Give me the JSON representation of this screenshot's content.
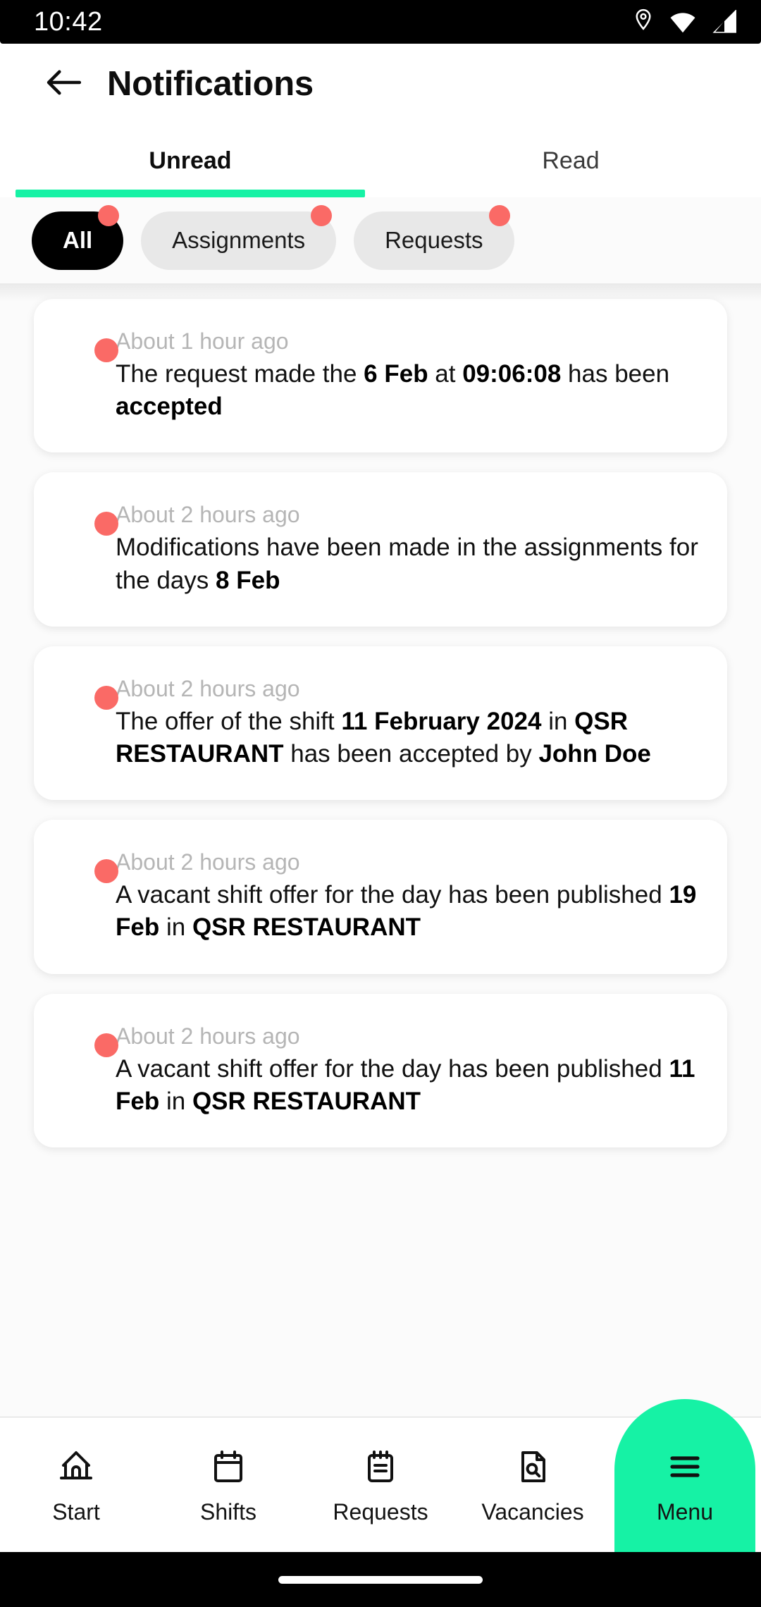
{
  "status_bar": {
    "time": "10:42",
    "icons": [
      "location-icon",
      "wifi-icon",
      "signal-icon"
    ]
  },
  "header": {
    "back_icon": "arrow-left-icon",
    "title": "Notifications"
  },
  "tabs": [
    {
      "label": "Unread",
      "active": true
    },
    {
      "label": "Read",
      "active": false
    }
  ],
  "filter_chips": [
    {
      "label": "All",
      "selected": true,
      "badge": true
    },
    {
      "label": "Assignments",
      "selected": false,
      "badge": true
    },
    {
      "label": "Requests",
      "selected": false,
      "badge": true
    }
  ],
  "notifications": [
    {
      "unread": true,
      "time": "About 1 hour ago",
      "segments": [
        {
          "t": "The request made the ",
          "b": false
        },
        {
          "t": "6 Feb",
          "b": true
        },
        {
          "t": " at ",
          "b": false
        },
        {
          "t": "09:06:08",
          "b": true
        },
        {
          "t": " has been ",
          "b": false
        },
        {
          "t": "accepted",
          "b": true
        }
      ]
    },
    {
      "unread": true,
      "time": "About 2 hours ago",
      "segments": [
        {
          "t": "Modifications have been made in the assignments for the days ",
          "b": false
        },
        {
          "t": "8 Feb",
          "b": true
        }
      ]
    },
    {
      "unread": true,
      "time": "About 2 hours ago",
      "segments": [
        {
          "t": "The offer of the shift ",
          "b": false
        },
        {
          "t": "11 February 2024",
          "b": true
        },
        {
          "t": " in ",
          "b": false
        },
        {
          "t": "QSR RESTAURANT",
          "b": true
        },
        {
          "t": " has been accepted by ",
          "b": false
        },
        {
          "t": "John Doe",
          "b": true
        }
      ]
    },
    {
      "unread": true,
      "time": "About 2 hours ago",
      "segments": [
        {
          "t": "A vacant shift offer for the day has been published ",
          "b": false
        },
        {
          "t": "19 Feb",
          "b": true
        },
        {
          "t": " in ",
          "b": false
        },
        {
          "t": "QSR RESTAURANT",
          "b": true
        }
      ]
    },
    {
      "unread": true,
      "time": "About 2 hours ago",
      "segments": [
        {
          "t": "A vacant shift offer for the day has been published ",
          "b": false
        },
        {
          "t": "11 Feb",
          "b": true
        },
        {
          "t": " in ",
          "b": false
        },
        {
          "t": "QSR RESTAURANT",
          "b": true
        }
      ]
    }
  ],
  "bottom_nav": [
    {
      "label": "Start",
      "icon": "home-icon",
      "active": false
    },
    {
      "label": "Shifts",
      "icon": "calendar-icon",
      "active": false
    },
    {
      "label": "Requests",
      "icon": "notepad-icon",
      "active": false
    },
    {
      "label": "Vacancies",
      "icon": "document-search-icon",
      "active": false
    },
    {
      "label": "Menu",
      "icon": "hamburger-menu-icon",
      "active": true
    }
  ],
  "colors": {
    "accent_green": "#16f2a5",
    "badge_red": "#fa6a66",
    "chip_selected_bg": "#000000",
    "chip_bg": "#e8e8e8",
    "page_bg": "#fbfbfb"
  }
}
